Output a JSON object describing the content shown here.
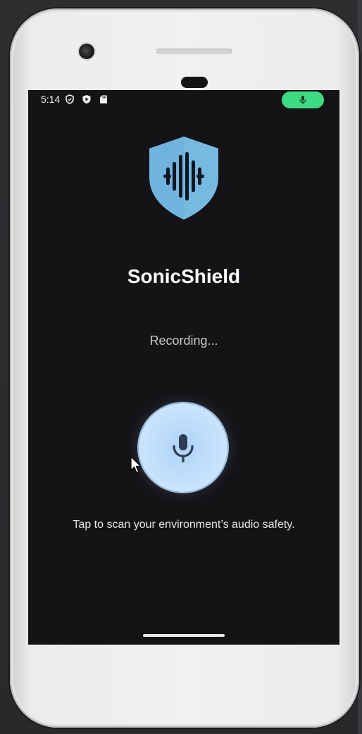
{
  "status_bar": {
    "time": "5:14",
    "icons": [
      "shield-outline-icon",
      "play-protect-icon",
      "sd-card-icon"
    ],
    "mic_indicator": "microphone-icon",
    "mic_indicator_color": "#3ddc84"
  },
  "app": {
    "logo": "shield-soundwave-logo",
    "logo_color": "#6fb4de",
    "title": "SonicShield",
    "status": "Recording...",
    "record_button_icon": "microphone-icon",
    "hint": "Tap to scan your environment’s audio safety."
  },
  "colors": {
    "screen_background": "#141417",
    "button_fill": "#c4e1fb",
    "mic_icon": "#2f3e52"
  }
}
